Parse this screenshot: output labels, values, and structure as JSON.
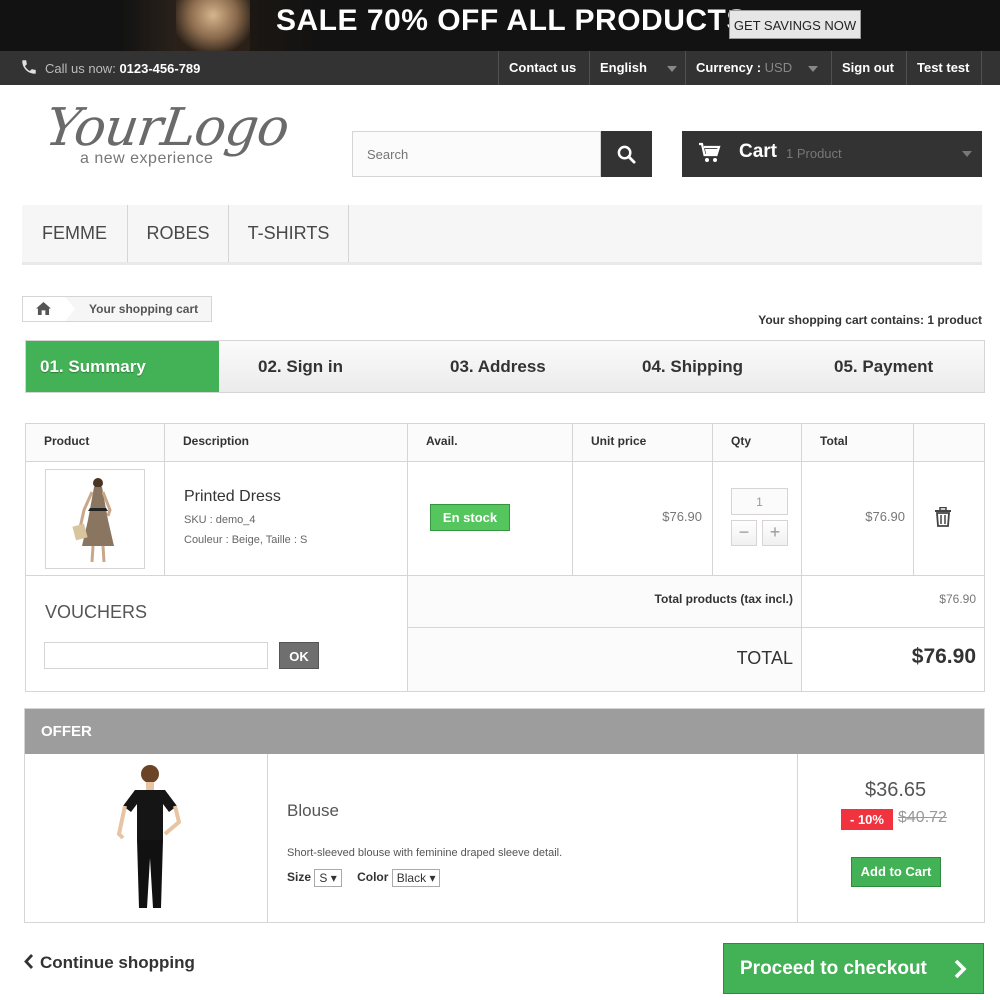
{
  "banner": {
    "headline": "SALE 70% OFF ALL PRODUCTS",
    "cta_label": "GET SAVINGS NOW"
  },
  "topnav": {
    "call_label": "Call us now:",
    "phone": "0123-456-789",
    "contact": "Contact us",
    "language": "English",
    "currency_label": "Currency :",
    "currency_value": "USD",
    "sign_out": "Sign out",
    "user": "Test test"
  },
  "logo": {
    "main": "YourLogo",
    "tagline": "a new experience"
  },
  "search": {
    "placeholder": "Search"
  },
  "cart": {
    "label": "Cart",
    "count": "1 Product"
  },
  "menu": {
    "items": [
      "FEMME",
      "ROBES",
      "T-SHIRTS"
    ]
  },
  "breadcrumb": {
    "current": "Your shopping cart"
  },
  "cart_contains": "Your shopping cart contains: 1 product",
  "steps": [
    "01. Summary",
    "02. Sign in",
    "03. Address",
    "04. Shipping",
    "05. Payment"
  ],
  "table": {
    "headers": {
      "product": "Product",
      "description": "Description",
      "avail": "Avail.",
      "unit_price": "Unit price",
      "qty": "Qty",
      "total": "Total"
    },
    "row": {
      "name": "Printed Dress",
      "sku": "SKU : demo_4",
      "attributes": "Couleur : Beige, Taille : S",
      "availability": "En stock",
      "unit_price": "$76.90",
      "qty": "1",
      "total": "$76.90"
    },
    "vouchers_title": "VOUCHERS",
    "ok_label": "OK",
    "total_products_label": "Total products (tax incl.)",
    "total_products_value": "$76.90",
    "total_label": "TOTAL",
    "total_value": "$76.90"
  },
  "offer": {
    "header": "OFFER",
    "name": "Blouse",
    "description": "Short-sleeved blouse with feminine draped sleeve detail.",
    "size_label": "Size",
    "size_value": "S",
    "color_label": "Color",
    "color_value": "Black",
    "price": "$36.65",
    "discount": "- 10%",
    "old_price": "$40.72",
    "add_label": "Add to Cart"
  },
  "actions": {
    "continue": "Continue shopping",
    "checkout": "Proceed to checkout"
  },
  "colors": {
    "accent_green": "#43b155",
    "dark": "#333333",
    "discount_red": "#f13340"
  }
}
